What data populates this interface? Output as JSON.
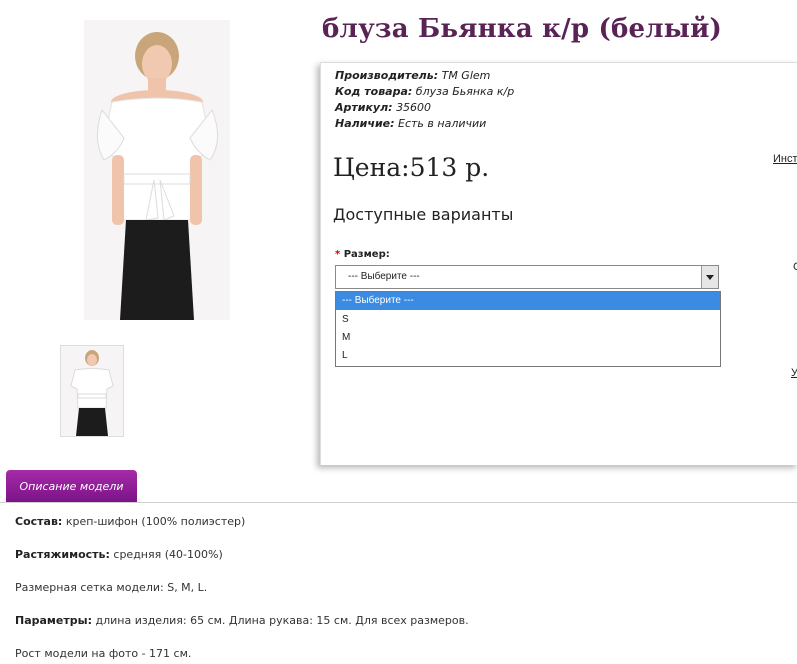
{
  "product": {
    "title": "блуза Бьянка к/р (белый)",
    "manufacturer_label": "Производитель:",
    "manufacturer": "ТМ Glem",
    "code_label": "Код товара:",
    "code": "блуза Бьянка к/р",
    "sku_label": "Артикул:",
    "sku": "35600",
    "stock_label": "Наличие:",
    "stock": "Есть в наличии",
    "price": "Цена:513 р."
  },
  "options": {
    "heading": "Доступные варианты",
    "size_label": "Размер:",
    "required_mark": "*",
    "size_selected": "--- Выберите ---",
    "size_options": [
      "--- Выберите ---",
      "S",
      "M",
      "L"
    ]
  },
  "side_links": {
    "top": "Инст",
    "middle": "С",
    "bottom": "У"
  },
  "description": {
    "tab_label": "Описание модели",
    "composition_label": "Состав:",
    "composition": "креп-шифон (100% полиэстер)",
    "stretch_label": "Растяжимость:",
    "stretch": "средняя (40-100%)",
    "size_grid": "Размерная сетка модели: S, M, L.",
    "params_label": "Параметры:",
    "params": "длина изделия: 65 см. Длина рукава: 15 см. Для всех размеров.",
    "model_height": "Рост модели на фото - 171 см."
  },
  "colors": {
    "title": "#5a2356",
    "tab": "#8e1f96",
    "selected_option": "#3b8be3"
  }
}
